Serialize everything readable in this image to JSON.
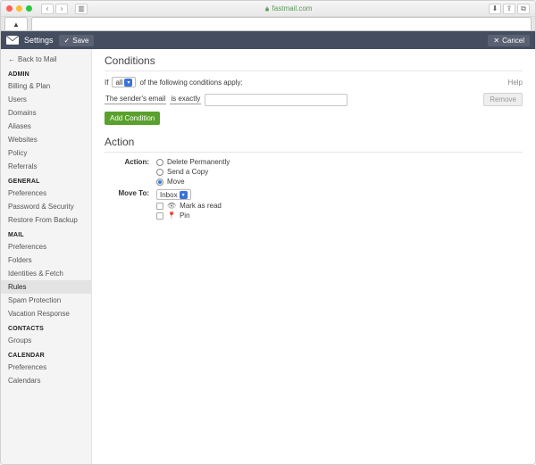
{
  "browser": {
    "url_host": "fastmail.com",
    "tab_icon_label": "▲"
  },
  "app": {
    "title": "Settings",
    "save_label": "Save",
    "cancel_label": "Cancel"
  },
  "sidebar": {
    "back_label": "Back to Mail",
    "sections": [
      {
        "heading": "ADMIN",
        "items": [
          "Billing & Plan",
          "Users",
          "Domains",
          "Aliases",
          "Websites",
          "Policy",
          "Referrals"
        ]
      },
      {
        "heading": "GENERAL",
        "items": [
          "Preferences",
          "Password & Security",
          "Restore From Backup"
        ]
      },
      {
        "heading": "MAIL",
        "items": [
          "Preferences",
          "Folders",
          "Identities & Fetch",
          "Rules",
          "Spam Protection",
          "Vacation Response"
        ],
        "active_index": 3
      },
      {
        "heading": "CONTACTS",
        "items": [
          "Groups"
        ]
      },
      {
        "heading": "CALENDAR",
        "items": [
          "Preferences",
          "Calendars"
        ]
      }
    ]
  },
  "conditions": {
    "heading": "Conditions",
    "if_label": "If",
    "match_scope": "all",
    "tail_label": "of the following conditions apply:",
    "help_label": "Help",
    "field": "The sender's email",
    "operator": "is exactly",
    "value": "",
    "remove_label": "Remove",
    "add_label": "Add Condition"
  },
  "action": {
    "heading": "Action",
    "action_label": "Action:",
    "options": [
      "Delete Permanently",
      "Send a Copy",
      "Move"
    ],
    "selected_index": 2,
    "moveto_label": "Move To:",
    "moveto_value": "Inbox",
    "flag_mark_read": "Mark as read",
    "flag_pin": "Pin"
  }
}
